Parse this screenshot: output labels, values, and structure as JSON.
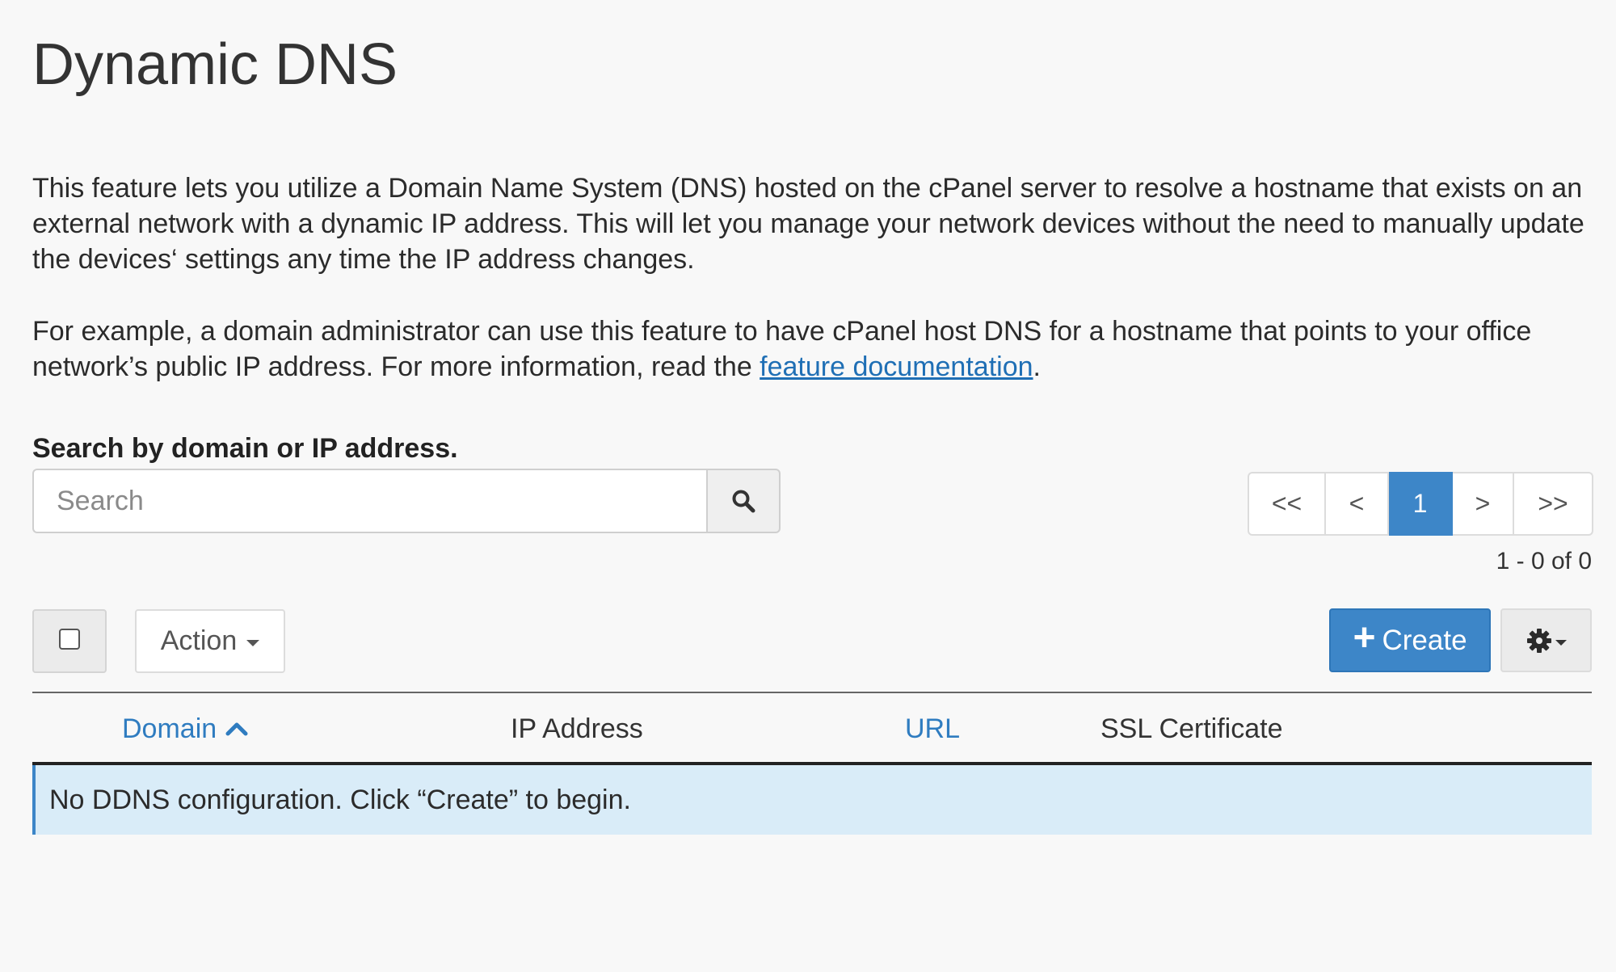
{
  "page": {
    "title": "Dynamic DNS",
    "intro_1": "This feature lets you utilize a Domain Name System (DNS) hosted on the cPanel server to resolve a hostname that exists on an external network with a dynamic IP address. This will let you manage your network devices without the need to manually update the devices‘ settings any time the IP address changes.",
    "intro_2_text": "For example, a domain administrator can use this feature to have cPanel host DNS for a hostname that points to your office network’s public IP address. For more information, read the ",
    "intro_2_link": "feature documentation",
    "intro_2_end": "."
  },
  "search": {
    "label": "Search by domain or IP address.",
    "placeholder": "Search",
    "value": ""
  },
  "pagination": {
    "first": "<<",
    "prev": "<",
    "current": "1",
    "next": ">",
    "last": ">>",
    "count": "1 - 0 of 0"
  },
  "toolbar": {
    "action_label": "Action",
    "create_label": "Create"
  },
  "table": {
    "columns": [
      {
        "label": "Domain",
        "sortable": true,
        "sorted": "asc"
      },
      {
        "label": "IP Address",
        "sortable": false
      },
      {
        "label": "URL",
        "sortable": true
      },
      {
        "label": "SSL Certificate",
        "sortable": false
      }
    ],
    "empty_message": "No DDNS configuration. Click “Create” to begin."
  },
  "colors": {
    "accent": "#3d86c8",
    "link": "#1f6fb5",
    "info_bg": "#d9ecf8",
    "page_bg": "#f8f8f8"
  },
  "icons": {
    "search": "search-icon",
    "sort": "chevron-up-icon",
    "create": "plus-icon",
    "settings": "gear-icon",
    "dropdown": "caret-down-icon"
  }
}
